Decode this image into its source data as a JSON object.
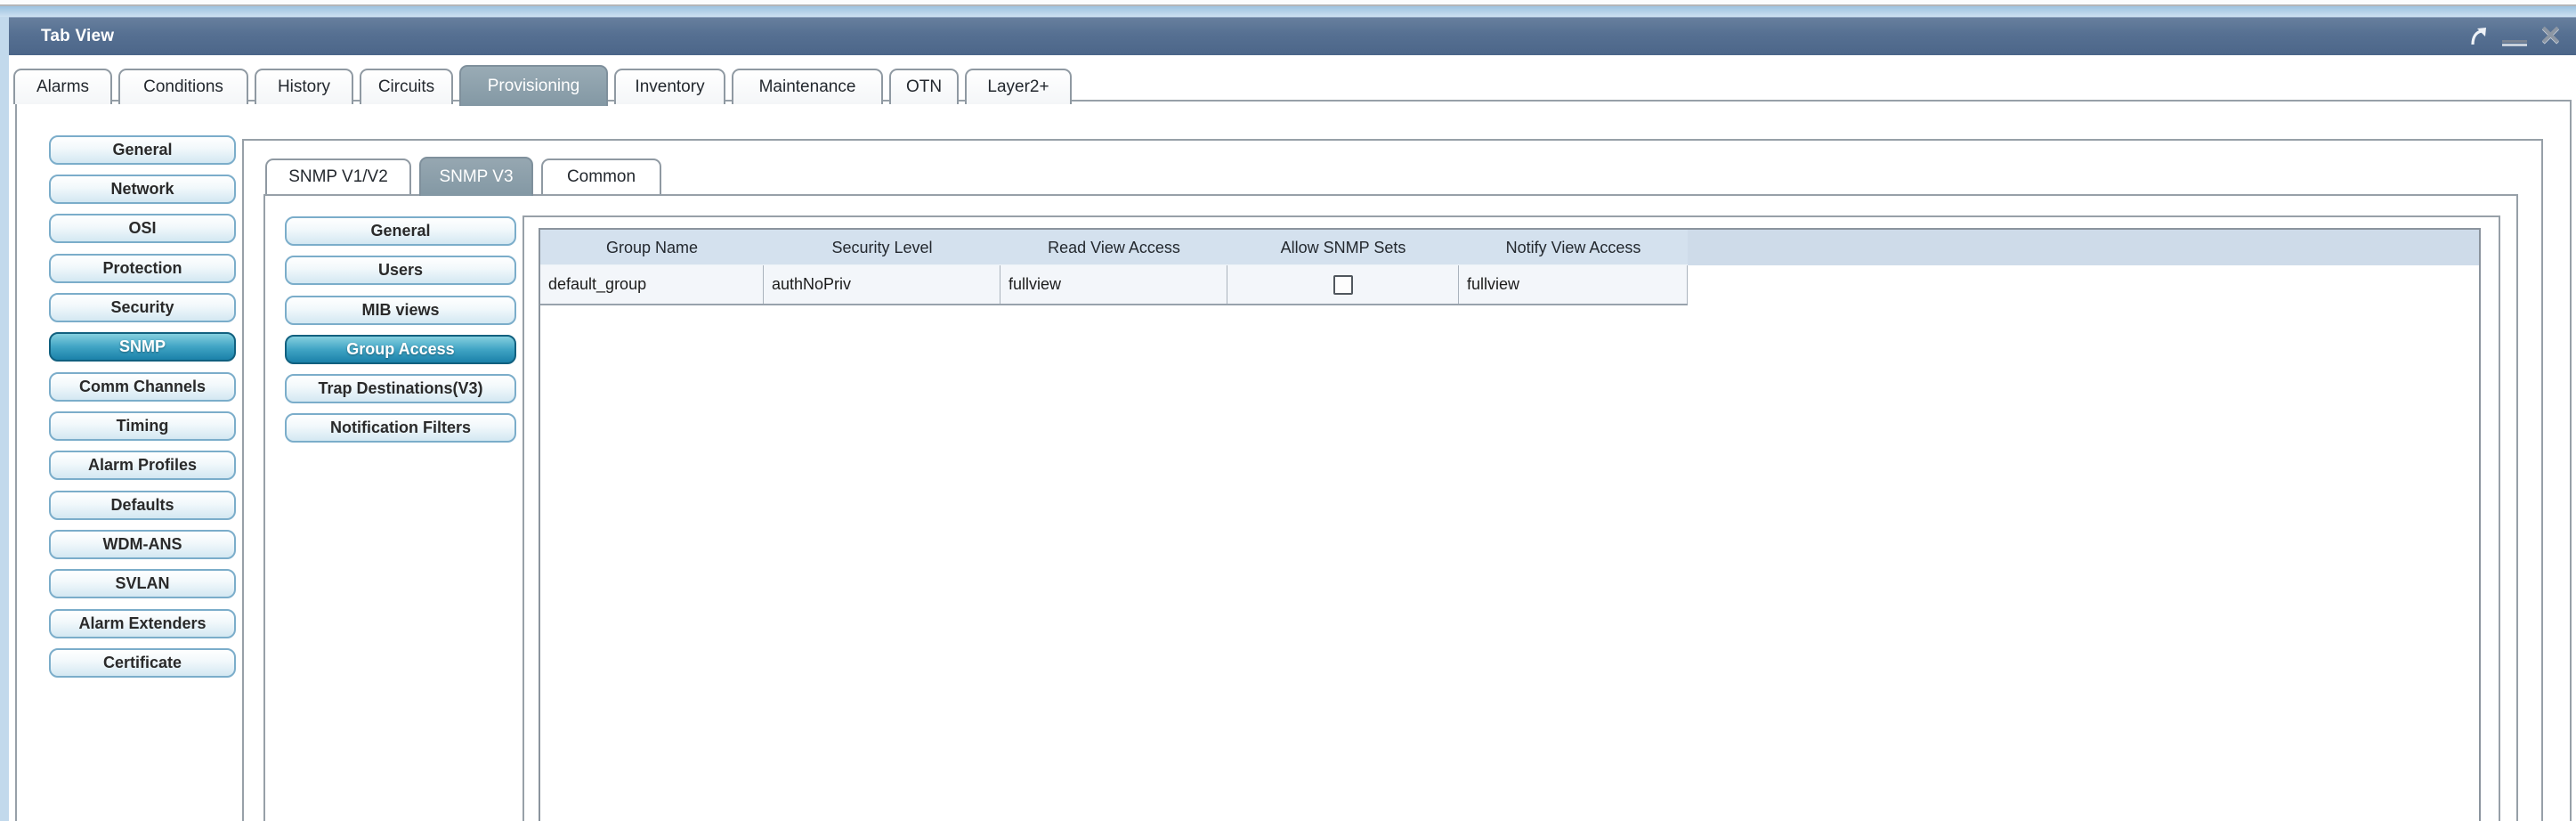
{
  "window": {
    "title": "Tab View",
    "controls": {
      "float": "float-arrow-icon",
      "minimize": "minimize-icon",
      "close": "close-icon"
    }
  },
  "main_tabs": {
    "items": [
      {
        "label": "Alarms",
        "selected": false
      },
      {
        "label": "Conditions",
        "selected": false
      },
      {
        "label": "History",
        "selected": false
      },
      {
        "label": "Circuits",
        "selected": false
      },
      {
        "label": "Provisioning",
        "selected": true
      },
      {
        "label": "Inventory",
        "selected": false
      },
      {
        "label": "Maintenance",
        "selected": false
      },
      {
        "label": "OTN",
        "selected": false
      },
      {
        "label": "Layer2+",
        "selected": false
      }
    ]
  },
  "provisioning_nav": {
    "items": [
      {
        "label": "General",
        "selected": false
      },
      {
        "label": "Network",
        "selected": false
      },
      {
        "label": "OSI",
        "selected": false
      },
      {
        "label": "Protection",
        "selected": false
      },
      {
        "label": "Security",
        "selected": false
      },
      {
        "label": "SNMP",
        "selected": true
      },
      {
        "label": "Comm Channels",
        "selected": false
      },
      {
        "label": "Timing",
        "selected": false
      },
      {
        "label": "Alarm Profiles",
        "selected": false
      },
      {
        "label": "Defaults",
        "selected": false
      },
      {
        "label": "WDM-ANS",
        "selected": false
      },
      {
        "label": "SVLAN",
        "selected": false
      },
      {
        "label": "Alarm Extenders",
        "selected": false
      },
      {
        "label": "Certificate",
        "selected": false
      }
    ]
  },
  "snmp_tabs": {
    "items": [
      {
        "label": "SNMP V1/V2",
        "selected": false
      },
      {
        "label": "SNMP V3",
        "selected": true
      },
      {
        "label": "Common",
        "selected": false
      }
    ]
  },
  "snmp_v3_nav": {
    "items": [
      {
        "label": "General",
        "selected": false
      },
      {
        "label": "Users",
        "selected": false
      },
      {
        "label": "MIB views",
        "selected": false
      },
      {
        "label": "Group Access",
        "selected": true
      },
      {
        "label": "Trap Destinations(V3)",
        "selected": false
      },
      {
        "label": "Notification Filters",
        "selected": false
      }
    ]
  },
  "group_access_table": {
    "columns": [
      "Group Name",
      "Security Level",
      "Read View Access",
      "Allow SNMP Sets",
      "Notify View Access"
    ],
    "rows": [
      {
        "group_name": "default_group",
        "security_level": "authNoPriv",
        "read_view_access": "fullview",
        "allow_snmp_sets": false,
        "notify_view_access": "fullview"
      }
    ]
  },
  "colors": {
    "titlebar": "#51698d",
    "selected_tab": "#8a9daa",
    "selected_nav_button_top": "#85cfdf",
    "selected_nav_button_bottom": "#1b81a9",
    "table_header_bg": "#d4e1ee",
    "table_row_bg": "#f3f6fa",
    "desktop_strip": "#9cc2e0"
  }
}
